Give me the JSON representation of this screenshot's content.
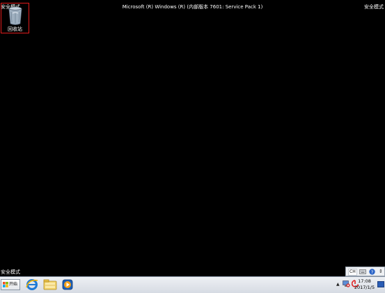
{
  "desktop": {
    "banner": "Microsoft (R) Windows (R) (内部版本 7601: Service Pack 1)",
    "safe_mode_top_left": "安全模式",
    "safe_mode_top_right": "安全模式",
    "safe_mode_bottom_left": "安全模式",
    "background_color": "#000000",
    "icons": [
      {
        "label": "回收站",
        "icon": "recycle-bin-icon",
        "selected": true
      }
    ]
  },
  "language_bar": {
    "lang": "CH",
    "icons": [
      "keyboard-icon",
      "help-icon",
      "options-icon"
    ]
  },
  "taskbar": {
    "start_label": "开始",
    "pinned": [
      "internet-explorer-icon",
      "windows-explorer-icon",
      "media-player-icon"
    ],
    "tray_icons": [
      "show-hidden-icons",
      "network-icon",
      "app-tray-icon"
    ],
    "clock": {
      "time": "17:08",
      "date": "2017/1/5"
    }
  },
  "colors": {
    "selection_border": "#e21c1c",
    "taskbar": "#dfe3e9"
  }
}
